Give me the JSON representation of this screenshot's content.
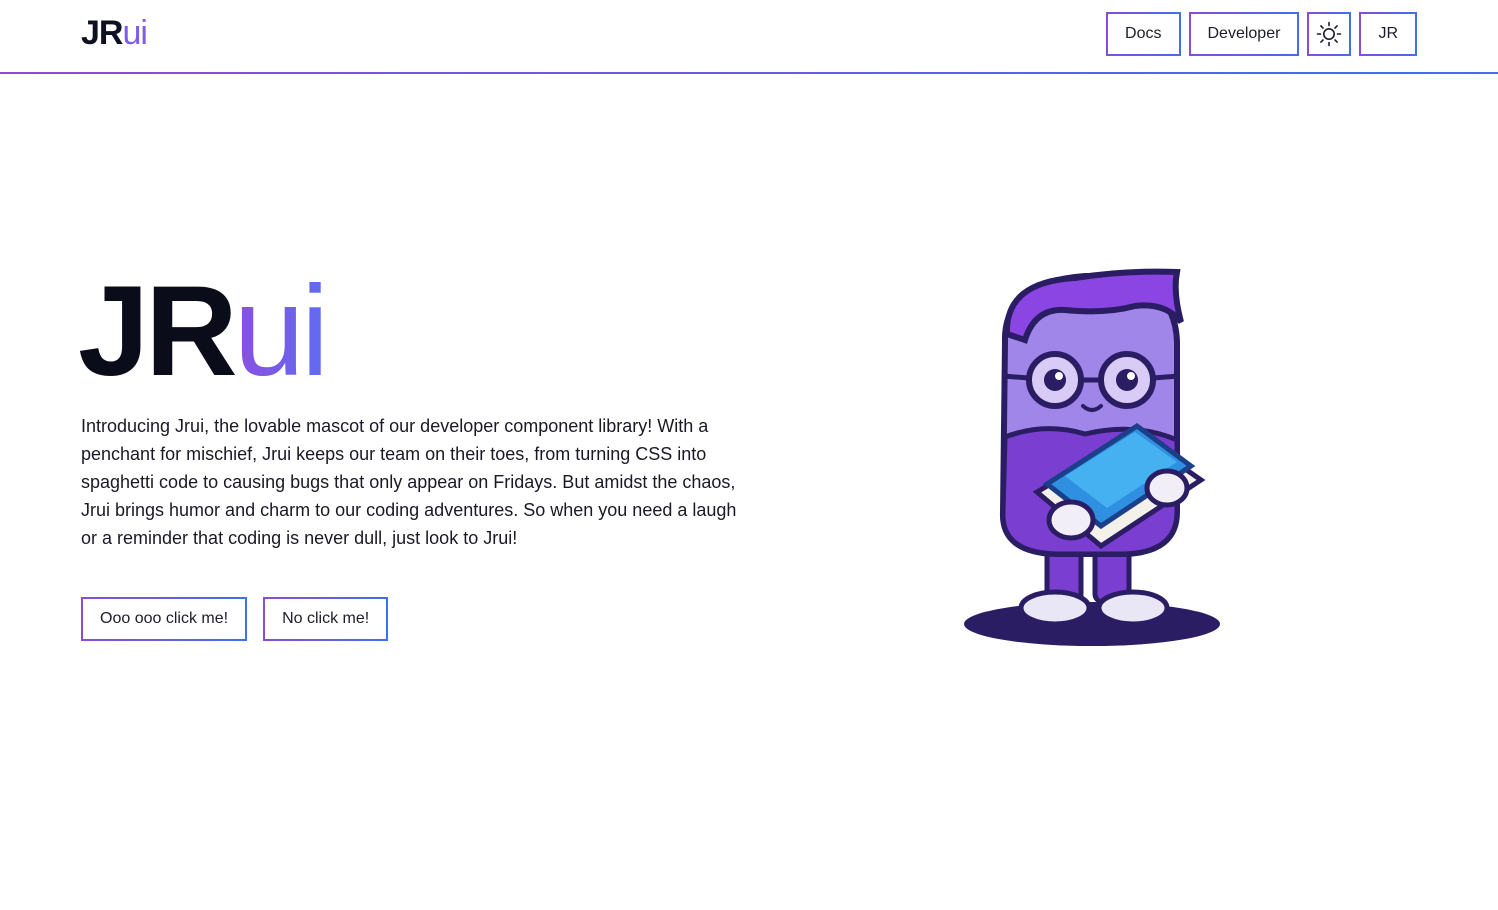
{
  "header": {
    "logo_bold": "JR",
    "logo_light": "ui",
    "nav": {
      "docs_label": "Docs",
      "developer_label": "Developer",
      "theme_icon": "sun-icon",
      "user_label": "JR"
    }
  },
  "hero": {
    "title_bold": "JR",
    "title_light": "ui",
    "intro": "Introducing Jrui, the lovable mascot of our developer component library! With a penchant for mischief, Jrui keeps our team on their toes, from turning CSS into spaghetti code to causing bugs that only appear on Fridays. But amidst the chaos, Jrui brings humor and charm to our coding adventures. So when you need a laugh or a reminder that coding is never dull, just look to Jrui!",
    "primary_button": "Ooo ooo click me!",
    "secondary_button": "No click me!"
  },
  "colors": {
    "accent_purple": "#8a4bd6",
    "accent_blue": "#3f6ff0",
    "text_dark": "#0f1020"
  }
}
